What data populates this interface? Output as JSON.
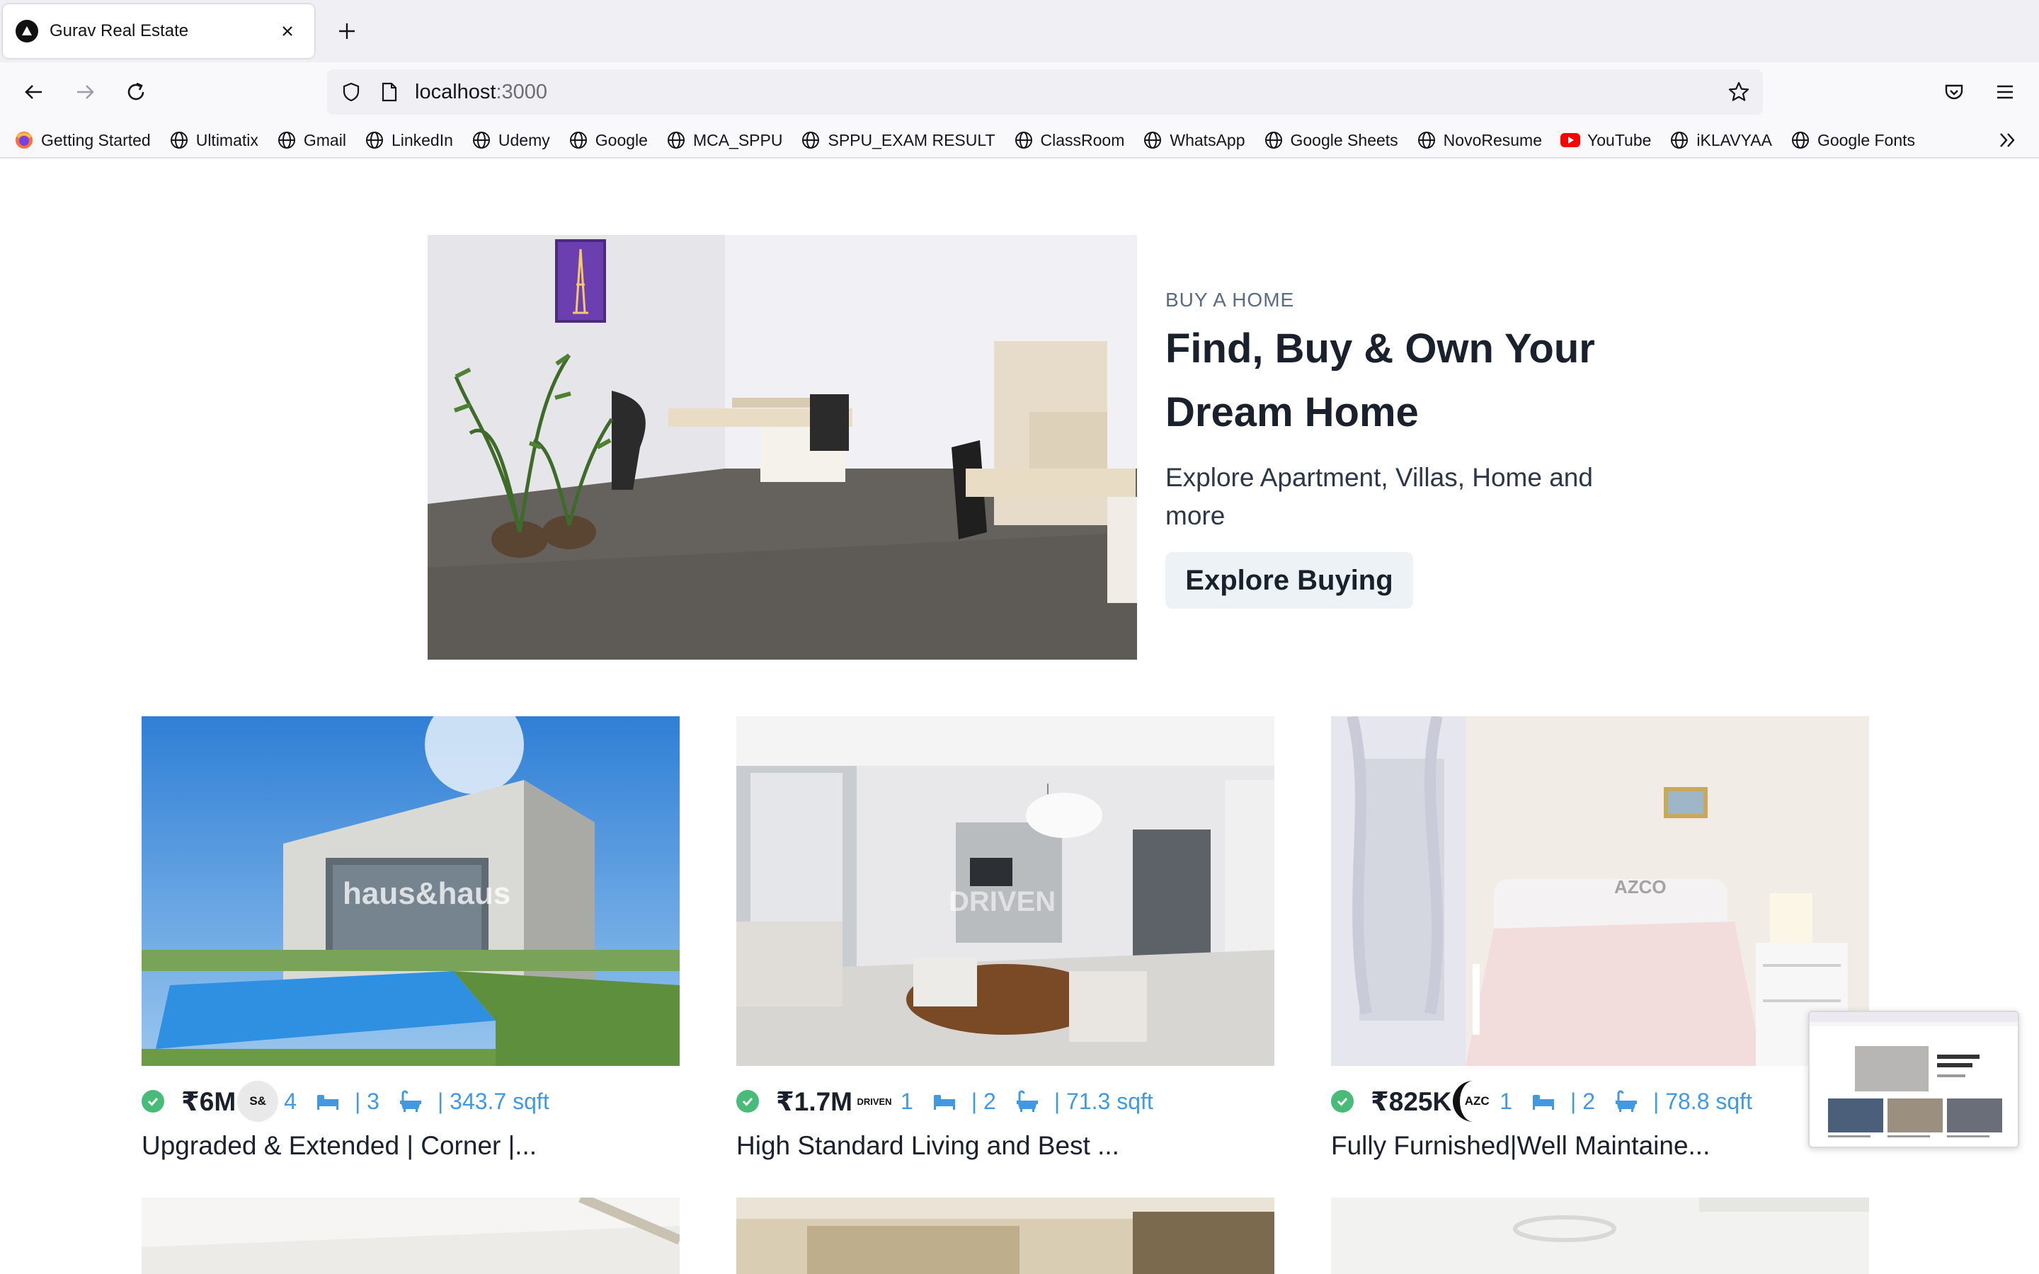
{
  "browser": {
    "tab": {
      "title": "Gurav Real Estate"
    },
    "address": {
      "host": "localhost",
      "port": ":3000"
    },
    "bookmarks": [
      "Getting Started",
      "Ultimatix",
      "Gmail",
      "LinkedIn",
      "Udemy",
      "Google",
      "MCA_SPPU",
      "SPPU_EXAM RESULT",
      "ClassRoom",
      "WhatsApp",
      "Google Sheets",
      "NovoResume",
      "YouTube",
      "iKLAVYAA",
      "Google Fonts"
    ]
  },
  "hero": {
    "eyebrow": "BUY A HOME",
    "title": "Find, Buy & Own Your Dream Home",
    "description": "Explore Apartment, Villas, Home and more",
    "button": "Explore Buying"
  },
  "cards": [
    {
      "price": "₹6M",
      "agency": "S&",
      "rooms": "4",
      "baths": "| 3",
      "area": "| 343.7 sqft",
      "title": "Upgraded & Extended | Corner |...",
      "watermark": "haus&haus"
    },
    {
      "price": "₹1.7M",
      "agency": "DRIVEN",
      "rooms": "1",
      "baths": "| 2",
      "area": "| 71.3 sqft",
      "title": "High Standard Living and Best ...",
      "watermark": "DRIVEN"
    },
    {
      "price": "₹825K",
      "agency": "AZC",
      "rooms": "1",
      "baths": "| 2",
      "area": "| 78.8 sqft",
      "title": "Fully Furnished|Well Maintaine...",
      "watermark": "AZCO"
    }
  ],
  "colors": {
    "accent": "#4299e1",
    "verified": "#48bb78",
    "button_bg": "#edf2f7"
  }
}
